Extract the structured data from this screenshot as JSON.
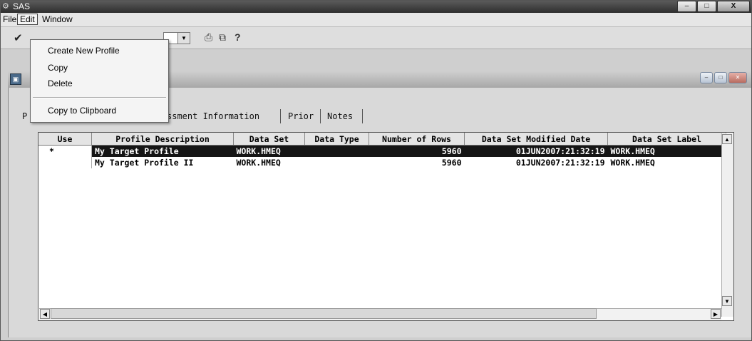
{
  "window": {
    "title": "SAS",
    "min_label": "–",
    "max_label": "□",
    "close_label": "X"
  },
  "menubar": {
    "file": "File",
    "edit": "Edit",
    "window": "Window"
  },
  "edit_menu": {
    "items": [
      {
        "label": "Create New Profile"
      },
      {
        "label": "Copy"
      },
      {
        "label": "Delete"
      },
      {
        "label": "Copy to Clipboard"
      }
    ]
  },
  "toolbar": {
    "check_icon": "✔",
    "print_icon": "🖨",
    "copy_icon": "⎘",
    "help_label": "?"
  },
  "tabs": {
    "first_partial": "P",
    "assessment": "ssment Information",
    "prior": "Prior",
    "notes": "Notes"
  },
  "grid": {
    "columns": [
      "Use",
      "Profile Description",
      "Data Set",
      "Data Type",
      "Number of Rows",
      "Data Set Modified Date",
      "Data Set Label"
    ],
    "rows": [
      {
        "use": "*",
        "description": "My Target Profile",
        "data_set": "WORK.HMEQ",
        "data_type": "",
        "rows": "5960",
        "modified": "01JUN2007:21:32:19",
        "label": "WORK.HMEQ"
      },
      {
        "use": "",
        "description": "My Target Profile II",
        "data_set": "WORK.HMEQ",
        "data_type": "",
        "rows": "5960",
        "modified": "01JUN2007:21:32:19",
        "label": "WORK.HMEQ"
      }
    ]
  },
  "colors": {
    "titlebar": "#3a3a3a",
    "selected_row": "#151515",
    "panel": "#d9d9d9"
  }
}
